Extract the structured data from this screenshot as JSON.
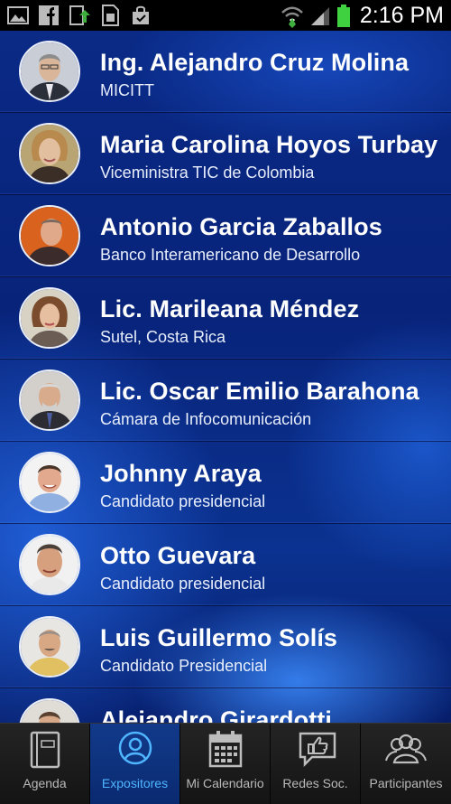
{
  "status_bar": {
    "time": "2:16 PM"
  },
  "speakers": [
    {
      "name": "Ing. Alejandro Cruz Molina",
      "role": "MICITT"
    },
    {
      "name": "Maria Carolina Hoyos Turbay",
      "role": "Viceministra TIC de Colombia"
    },
    {
      "name": "Antonio Garcia Zaballos",
      "role": "Banco Interamericano de Desarrollo"
    },
    {
      "name": "Lic. Marileana Méndez",
      "role": "Sutel, Costa Rica"
    },
    {
      "name": "Lic. Oscar Emilio Barahona",
      "role": "Cámara de Infocomunicación"
    },
    {
      "name": "Johnny Araya",
      "role": "Candidato presidencial"
    },
    {
      "name": "Otto Guevara",
      "role": "Candidato presidencial"
    },
    {
      "name": "Luis Guillermo Solís",
      "role": "Candidato Presidencial"
    },
    {
      "name": "Alejandro Girardotti",
      "role": ""
    }
  ],
  "tabs": [
    {
      "label": "Agenda",
      "icon": "book-icon",
      "active": false
    },
    {
      "label": "Expositores",
      "icon": "person-icon",
      "active": true
    },
    {
      "label": "Mi Calendario",
      "icon": "calendar-icon",
      "active": false
    },
    {
      "label": "Redes Soc.",
      "icon": "thumbs-up-icon",
      "active": false
    },
    {
      "label": "Participantes",
      "icon": "group-icon",
      "active": false
    }
  ],
  "colors": {
    "accent": "#4fb5ff",
    "background": "#0a2a86"
  }
}
